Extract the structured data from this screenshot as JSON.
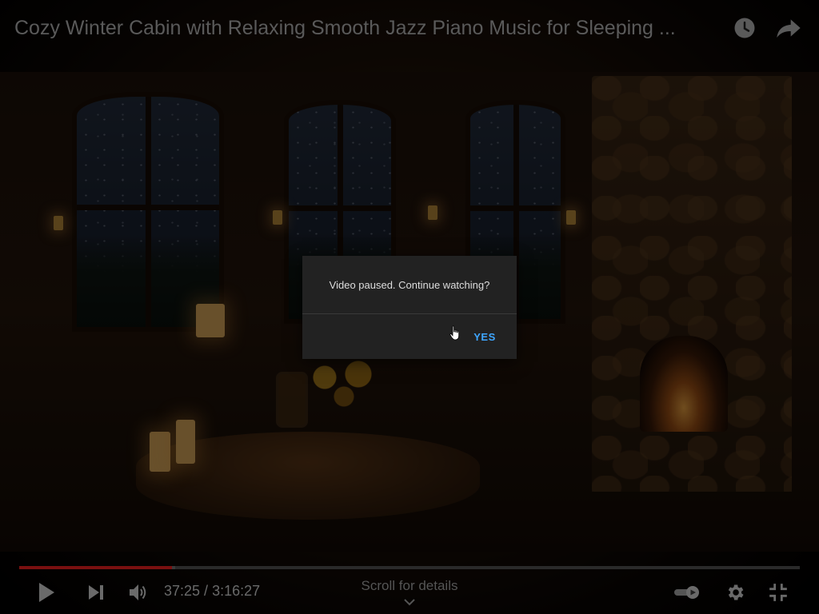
{
  "video": {
    "title": "Cozy Winter Cabin with Relaxing Smooth Jazz Piano Music for Sleeping ...",
    "current_time": "37:25",
    "duration": "3:16:27",
    "time_separator": " / ",
    "progress_fraction": 0.196,
    "buffer_fraction": 0.2
  },
  "top_actions": {
    "watch_later_icon": "clock-icon",
    "share_icon": "share-arrow-icon"
  },
  "dialog": {
    "message": "Video paused. Continue watching?",
    "confirm_label": "YES"
  },
  "controls": {
    "play_icon": "play-icon",
    "next_icon": "skip-next-icon",
    "volume_icon": "volume-icon",
    "autoplay_icon": "autoplay-toggle-icon",
    "settings_icon": "gear-icon",
    "exit_fullscreen_icon": "exit-fullscreen-icon",
    "scroll_hint": "Scroll for details"
  },
  "colors": {
    "accent": "#3ea6ff",
    "progress": "#7a1010"
  }
}
